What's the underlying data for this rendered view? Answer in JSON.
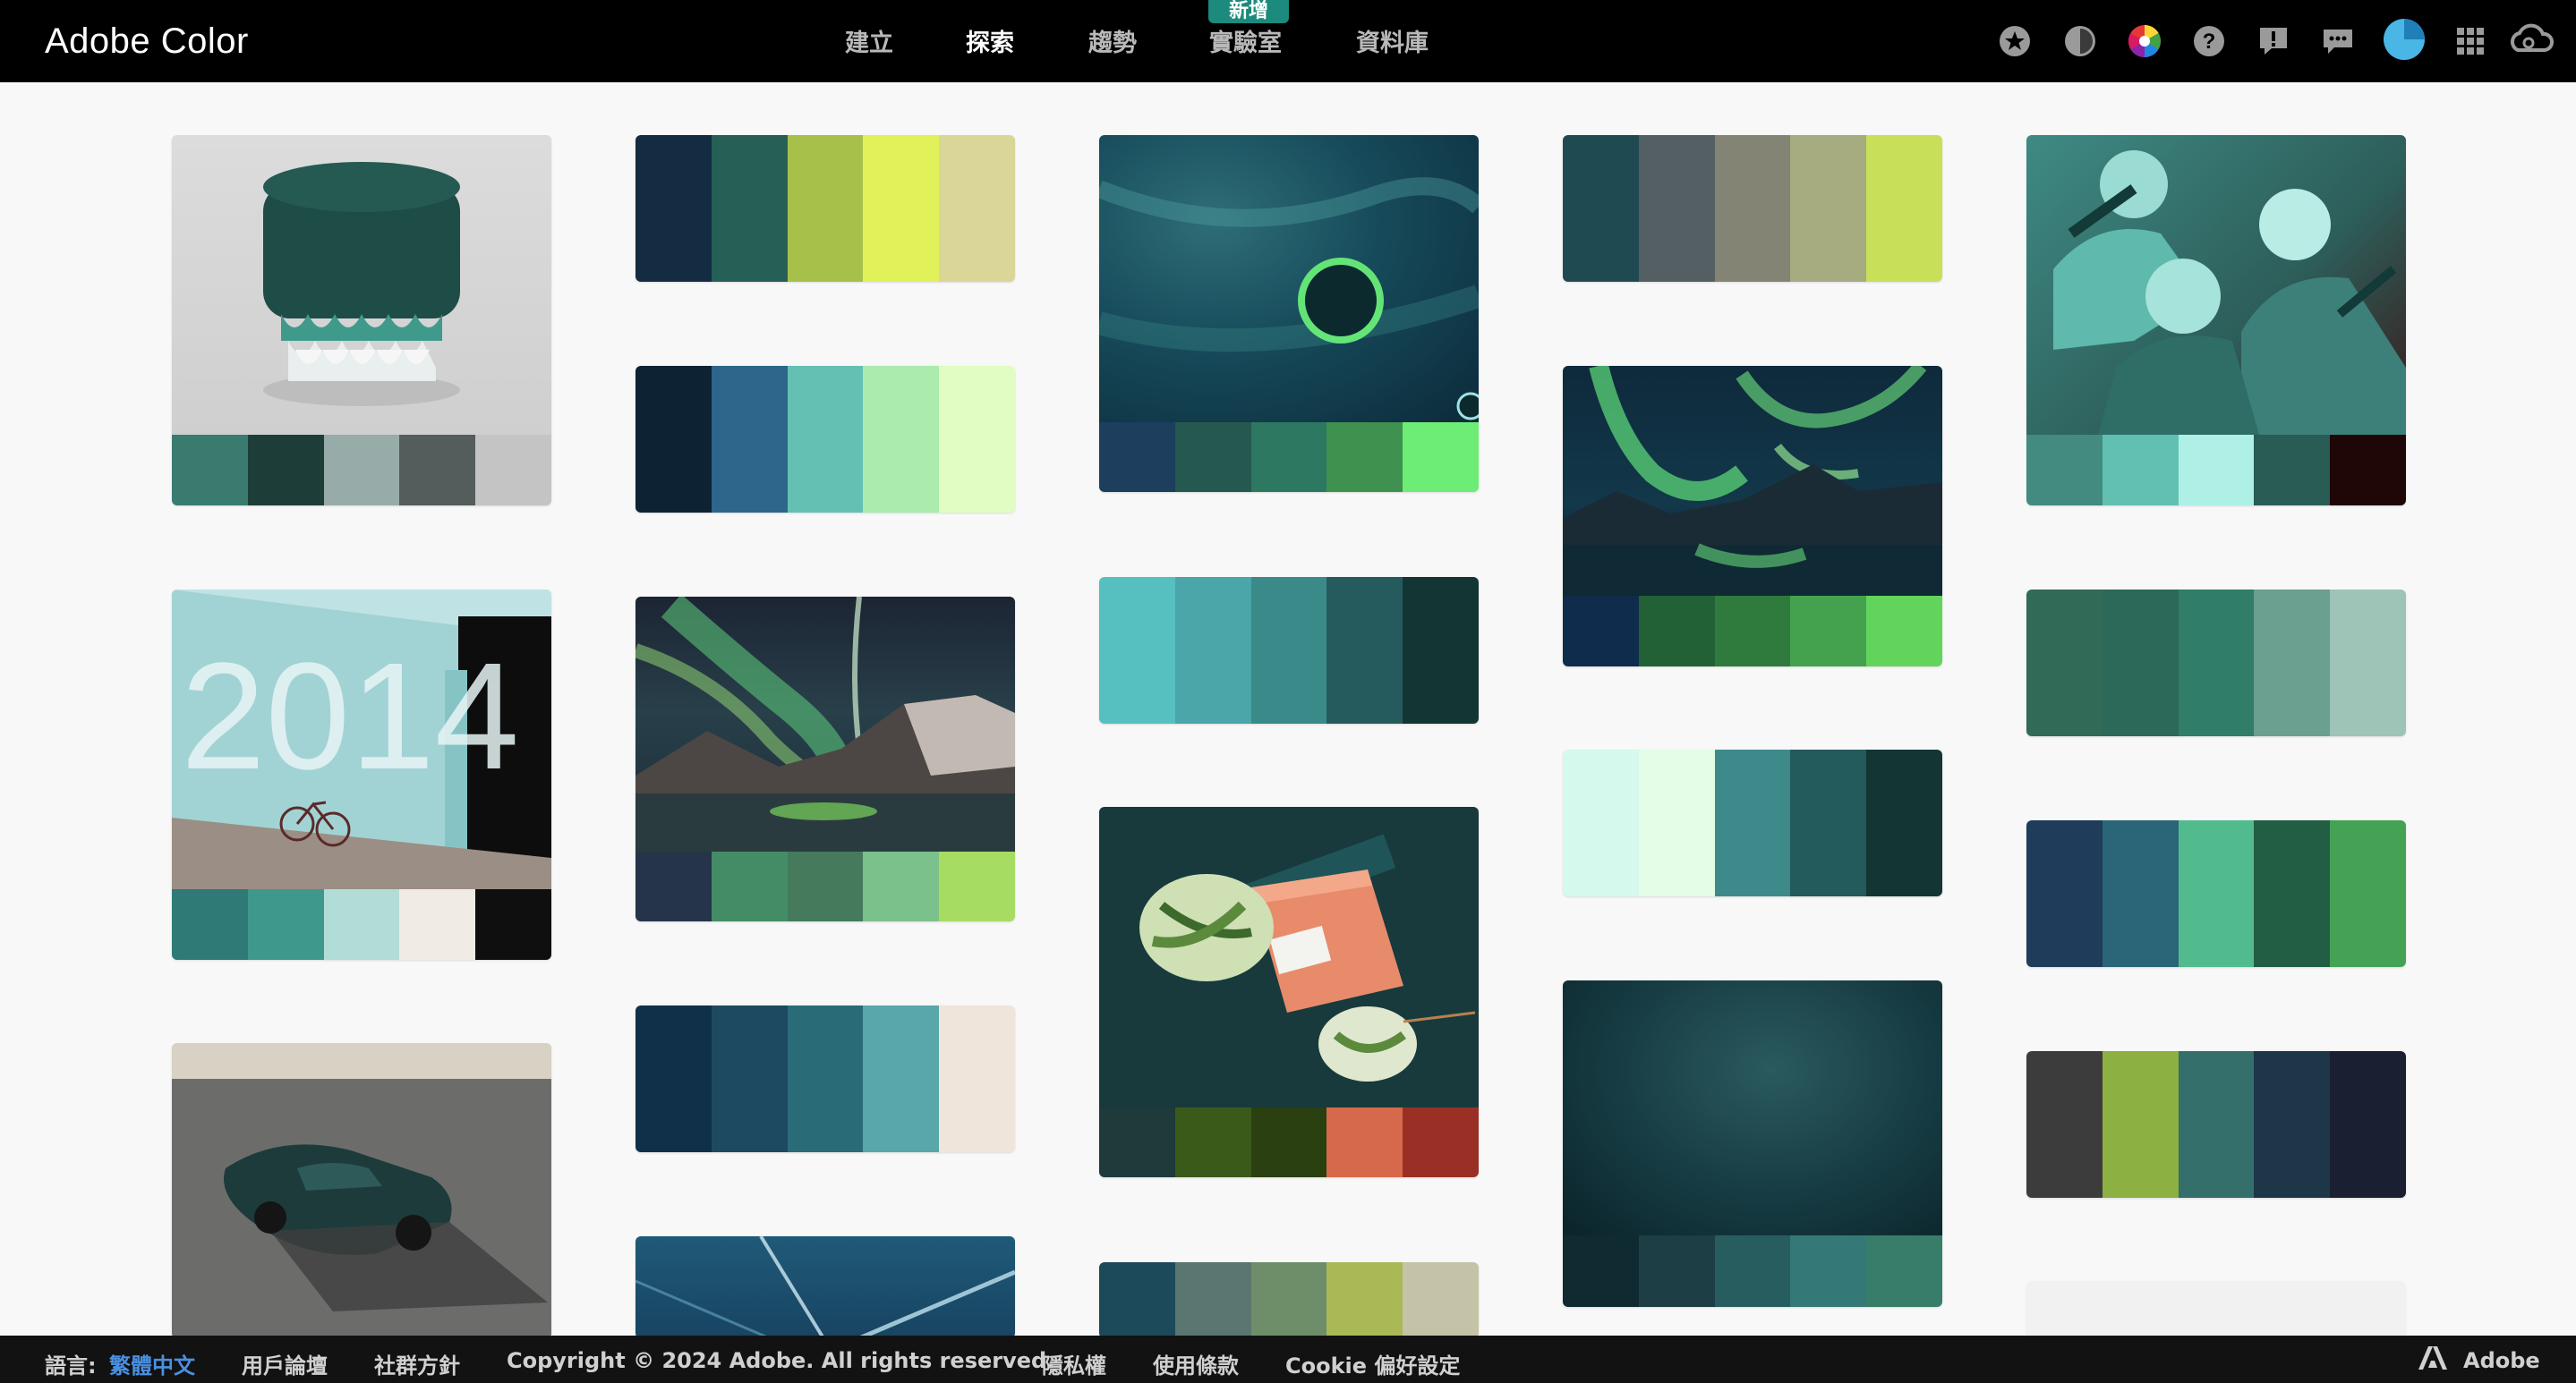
{
  "header": {
    "brand": "Adobe Color",
    "nav": [
      {
        "label": "建立",
        "active": false
      },
      {
        "label": "探索",
        "active": true
      },
      {
        "label": "趨勢",
        "active": false
      },
      {
        "label": "實驗室",
        "active": false
      },
      {
        "label": "資料庫",
        "active": false
      }
    ],
    "new_badge": "新增",
    "icons": [
      "star-icon",
      "contrast-icon",
      "color-wheel-icon",
      "help-icon",
      "feedback-icon",
      "chat-icon",
      "avatar",
      "apps-grid-icon",
      "creative-cloud-icon"
    ]
  },
  "cards": [
    {
      "name": "image-card-stool",
      "swatches": [
        "#3a7b70",
        "#1c3d38",
        "#97aca9",
        "#545d5b",
        "#c4c4c4"
      ]
    },
    {
      "name": "palette-card-1",
      "swatches": [
        "#132c42",
        "#265f55",
        "#a7c04a",
        "#e0f159",
        "#d9d698"
      ]
    },
    {
      "name": "image-card-space-planet",
      "swatches": [
        "#1d3e5c",
        "#25584e",
        "#2d7860",
        "#3f9150",
        "#6ded76"
      ]
    },
    {
      "name": "palette-card-2",
      "swatches": [
        "#204a52",
        "#535f62",
        "#838474",
        "#a6ab80",
        "#c8e059"
      ]
    },
    {
      "name": "image-card-illustration-men",
      "swatches": [
        "#438a80",
        "#62c0b2",
        "#aef0e6",
        "#285c55",
        "#1f0707"
      ]
    },
    {
      "name": "palette-card-3",
      "swatches": [
        "#0d2233",
        "#2e658a",
        "#63c0b3",
        "#abebad",
        "#e1fdc4"
      ]
    },
    {
      "name": "palette-card-4",
      "swatches": [
        "#56c0c0",
        "#4aa6a8",
        "#3a8a8a",
        "#255b5d",
        "#133534"
      ]
    },
    {
      "name": "image-card-aurora-lake",
      "swatches": [
        "#0f2c4c",
        "#226035",
        "#2f7a3d",
        "#44a24e",
        "#62d45b"
      ]
    },
    {
      "name": "image-card-wall-2014",
      "swatches": [
        "#2f7a76",
        "#3f988c",
        "#b2ddd6",
        "#f0ebe5",
        "#0f0f0f"
      ]
    },
    {
      "name": "image-card-aurora-mountains",
      "swatches": [
        "#25344a",
        "#438c66",
        "#457a5c",
        "#7bc18b",
        "#a7dc62"
      ]
    },
    {
      "name": "palette-card-5",
      "swatches": [
        "#316a57",
        "#2c6958",
        "#307e69",
        "#6b9f8f",
        "#9ec3b7"
      ]
    },
    {
      "name": "palette-card-6",
      "swatches": [
        "#d5f9ec",
        "#e3fde6",
        "#3e8a8a",
        "#235a5b",
        "#133534"
      ]
    },
    {
      "name": "palette-card-7",
      "swatches": [
        "#1f3c5a",
        "#2a6677",
        "#51bb8e",
        "#225e44",
        "#44a255"
      ]
    },
    {
      "name": "image-card-salt-leaf",
      "swatches": [
        "#1e3a3a",
        "#3a5a1a",
        "#2b4010",
        "#d6694b",
        "#9a3025"
      ]
    },
    {
      "name": "palette-card-8",
      "swatches": [
        "#10304a",
        "#1d4a60",
        "#2a6b78",
        "#59a6ab",
        "#f0e5da"
      ]
    },
    {
      "name": "image-card-dark-texture",
      "swatches": [
        "#0f2a30",
        "#1d3e45",
        "#285d60",
        "#357878",
        "#387c6a"
      ]
    },
    {
      "name": "palette-card-9",
      "swatches": [
        "#3c3c3c",
        "#8cb041",
        "#356f6b",
        "#1d3648",
        "#1a1f32"
      ]
    },
    {
      "name": "image-card-porsche",
      "swatches": []
    },
    {
      "name": "image-card-tunnel",
      "swatches": []
    },
    {
      "name": "palette-card-10",
      "swatches": [
        "#1c4a5a",
        "#5b7570",
        "#6e8e6a",
        "#aab856",
        "#c4c3a8"
      ]
    },
    {
      "name": "palette-card-placeholder",
      "swatches": []
    }
  ],
  "footer": {
    "lang_label": "語言:",
    "lang_value": "繁體中文",
    "forum": "用戶論壇",
    "community": "社群方針",
    "copyright": "Copyright © 2024 Adobe. All rights reserved.",
    "privacy": "隱私權",
    "terms": "使用條款",
    "cookie": "Cookie 偏好設定",
    "adobe": "Adobe"
  }
}
